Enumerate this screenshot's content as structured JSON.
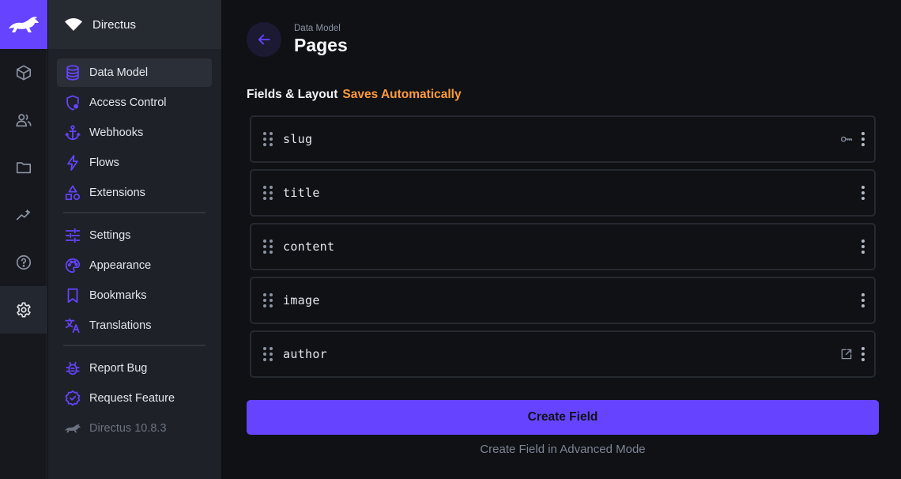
{
  "colors": {
    "accent": "#6644ff",
    "warning": "#ff9a3d",
    "background": "#0f1115",
    "nav_background": "#1e2127"
  },
  "module_bar": {
    "items": [
      {
        "icon": "cube-icon",
        "label": "Content"
      },
      {
        "icon": "users-icon",
        "label": "User Directory"
      },
      {
        "icon": "folder-icon",
        "label": "File Library"
      },
      {
        "icon": "insights-icon",
        "label": "Insights"
      },
      {
        "icon": "help-icon",
        "label": "Help"
      },
      {
        "icon": "gear-icon",
        "label": "Settings"
      }
    ]
  },
  "project": {
    "name": "Directus"
  },
  "nav": {
    "items": [
      {
        "label": "Data Model"
      },
      {
        "label": "Access Control"
      },
      {
        "label": "Webhooks"
      },
      {
        "label": "Flows"
      },
      {
        "label": "Extensions"
      },
      {
        "label": "Settings"
      },
      {
        "label": "Appearance"
      },
      {
        "label": "Bookmarks"
      },
      {
        "label": "Translations"
      },
      {
        "label": "Report Bug"
      },
      {
        "label": "Request Feature"
      },
      {
        "label": "Directus 10.8.3"
      }
    ]
  },
  "header": {
    "breadcrumb": "Data Model",
    "title": "Pages"
  },
  "section": {
    "title": "Fields & Layout",
    "status": "Saves Automatically"
  },
  "fields": [
    {
      "name": "slug",
      "icon": "key-icon"
    },
    {
      "name": "title",
      "icon": ""
    },
    {
      "name": "content",
      "icon": ""
    },
    {
      "name": "image",
      "icon": ""
    },
    {
      "name": "author",
      "icon": "open-in-new-icon"
    }
  ],
  "actions": {
    "create_field": "Create Field",
    "create_advanced": "Create Field in Advanced Mode"
  }
}
